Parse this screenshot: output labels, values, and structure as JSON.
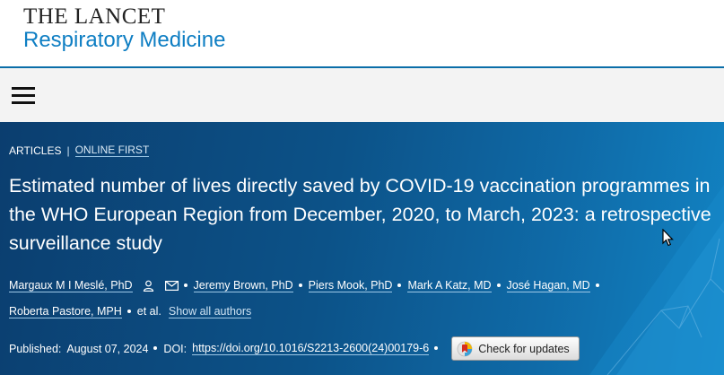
{
  "header": {
    "logo_line1": "THE LANCET",
    "logo_line2": "Respiratory Medicine"
  },
  "nav": {
    "menu_icon": "hamburger-menu-icon"
  },
  "article": {
    "type_label": "ARTICLES",
    "separator": "|",
    "status_label": "ONLINE FIRST",
    "title": "Estimated number of lives directly saved by COVID-19 vaccination programmes in the WHO European Region from December, 2020, to March, 2023: a retrospective surveillance study",
    "authors": [
      "Margaux M I Meslé, PhD",
      "Jeremy Brown, PhD",
      "Piers Mook, PhD",
      "Mark A Katz, MD",
      "José Hagan, MD",
      "Roberta Pastore, MPH"
    ],
    "et_al": "et al.",
    "show_all": "Show all authors",
    "published_label": "Published:",
    "published_date": "August 07, 2024",
    "doi_label": "DOI:",
    "doi": "https://doi.org/10.1016/S2213-2600(24)00179-6",
    "check_updates": "Check for updates"
  },
  "colors": {
    "brand_blue": "#0e7ec3",
    "hero_dark": "#0b3e6f",
    "hero_light": "#1284c4"
  }
}
